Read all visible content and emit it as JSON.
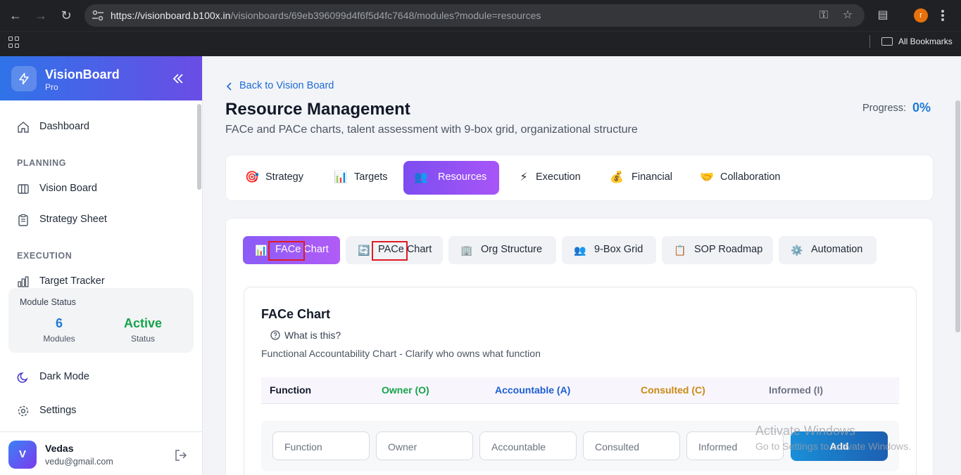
{
  "browser": {
    "url_host": "https://visionboard.b100x.in",
    "url_path": "/visionboards/69eb396099d4f6f5d4fc7648/modules?module=resources",
    "profile_initial": "r",
    "bookmarks_label": "All Bookmarks"
  },
  "sidebar": {
    "brand": "VisionBoard",
    "brand_sub": "Pro",
    "dashboard": "Dashboard",
    "planning_header": "PLANNING",
    "vision_board": "Vision Board",
    "strategy_sheet": "Strategy Sheet",
    "execution_header": "EXECUTION",
    "target_tracker": "Target Tracker",
    "status": {
      "title": "Module Status",
      "modules_value": "6",
      "modules_label": "Modules",
      "status_value": "Active",
      "status_label": "Status",
      "modules_color": "#1d7ad6",
      "status_color": "#16a34a"
    },
    "dark_mode": "Dark Mode",
    "settings": "Settings",
    "user": {
      "initial": "V",
      "name": "Vedas",
      "email": "vedu@gmail.com"
    }
  },
  "main": {
    "back_label": "Back to Vision Board",
    "title": "Resource Management",
    "subtitle": "FACe and PACe charts, talent assessment with 9-box grid, organizational structure",
    "progress_label": "Progress:",
    "progress_value": "0%",
    "tabs": [
      {
        "label": "Strategy",
        "icon": "dart-icon",
        "glyph": "🎯"
      },
      {
        "label": "Targets",
        "icon": "bar-chart-icon",
        "glyph": "📊"
      },
      {
        "label": "Resources",
        "icon": "people-icon",
        "glyph": "👥",
        "active": true
      },
      {
        "label": "Execution",
        "icon": "lightning-icon",
        "glyph": "⚡"
      },
      {
        "label": "Financial",
        "icon": "money-bag-icon",
        "glyph": "💰"
      },
      {
        "label": "Collaboration",
        "icon": "handshake-icon",
        "glyph": "🤝"
      }
    ],
    "subtabs": [
      {
        "label": "FACe Chart",
        "icon": "bar-chart-icon",
        "glyph": "📊",
        "active": true
      },
      {
        "label": "PACe Chart",
        "icon": "refresh-icon",
        "glyph": "🔄"
      },
      {
        "label": "Org Structure",
        "icon": "building-icon",
        "glyph": "🏢"
      },
      {
        "label": "9-Box Grid",
        "icon": "people-icon",
        "glyph": "👥"
      },
      {
        "label": "SOP Roadmap",
        "icon": "clipboard-icon",
        "glyph": "📋"
      },
      {
        "label": "Automation",
        "icon": "gear-icon",
        "glyph": "⚙️"
      }
    ],
    "card": {
      "title": "FACe Chart",
      "help": "What is this?",
      "description": "Functional Accountability Chart - Clarify who owns what function",
      "columns": [
        {
          "label": "Function",
          "color": "#111827"
        },
        {
          "label": "Owner (O)",
          "color": "#16a34a"
        },
        {
          "label": "Accountable (A)",
          "color": "#1d5fd0"
        },
        {
          "label": "Consulted (C)",
          "color": "#c98a12"
        },
        {
          "label": "Informed (I)",
          "color": "#6b7280"
        }
      ],
      "inputs": [
        "Function",
        "Owner",
        "Accountable",
        "Consulted",
        "Informed"
      ],
      "add_label": "Add"
    }
  },
  "watermark": {
    "line1": "Activate Windows",
    "line2": "Go to Settings to activate Windows."
  }
}
